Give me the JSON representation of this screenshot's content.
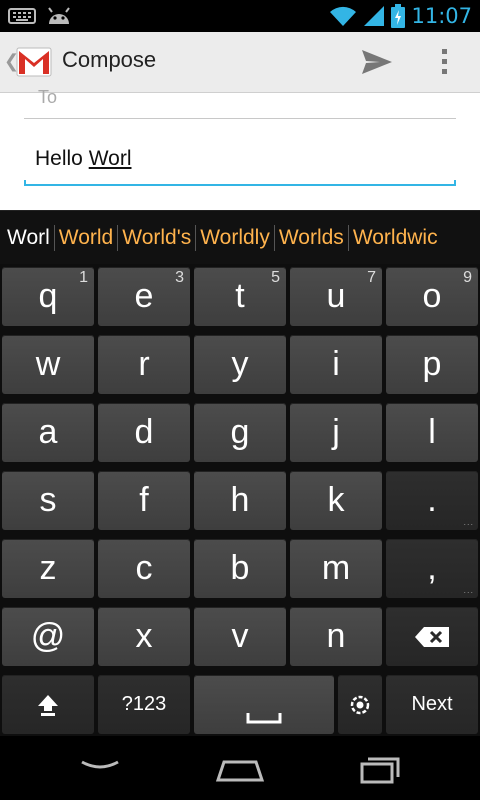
{
  "status": {
    "time": "11:07"
  },
  "actionbar": {
    "title": "Compose",
    "up_glyph": "❮"
  },
  "compose": {
    "to_label": "To",
    "body_prefix": "Hello ",
    "body_composing": "Worl"
  },
  "suggestions": [
    "Worl",
    "World",
    "World's",
    "Worldly",
    "Worlds",
    "Worldwic"
  ],
  "keyboard": {
    "row1": [
      {
        "label": "q",
        "hint": "1"
      },
      {
        "label": "e",
        "hint": "3"
      },
      {
        "label": "t",
        "hint": "5"
      },
      {
        "label": "u",
        "hint": "7"
      },
      {
        "label": "o",
        "hint": "9"
      }
    ],
    "row2": [
      {
        "label": "w"
      },
      {
        "label": "r"
      },
      {
        "label": "y"
      },
      {
        "label": "i"
      },
      {
        "label": "p"
      }
    ],
    "row3": [
      {
        "label": "a"
      },
      {
        "label": "d"
      },
      {
        "label": "g"
      },
      {
        "label": "j"
      },
      {
        "label": "l"
      }
    ],
    "row4": [
      {
        "label": "s"
      },
      {
        "label": "f"
      },
      {
        "label": "h"
      },
      {
        "label": "k"
      },
      {
        "label": "."
      }
    ],
    "row5": [
      {
        "label": "z"
      },
      {
        "label": "c"
      },
      {
        "label": "b"
      },
      {
        "label": "m"
      },
      {
        "label": ","
      }
    ],
    "row6": [
      {
        "label": "@"
      },
      {
        "label": "x"
      },
      {
        "label": "v"
      },
      {
        "label": "n"
      }
    ],
    "symbols_label": "?123",
    "next_label": "Next",
    "period_dots": "...",
    "comma_dots": "..."
  },
  "colors": {
    "accent": "#33b5e5",
    "suggestion": "#ffb34d",
    "gmail_red": "#d93025"
  },
  "icons": {
    "status_left": [
      "keyboard-icon",
      "android-icon"
    ],
    "status_right": [
      "wifi-icon",
      "signal-icon",
      "battery-icon"
    ],
    "actions": [
      "send-icon",
      "overflow-menu-icon"
    ],
    "keys": [
      "shift-icon",
      "space-icon",
      "settings-icon",
      "delete-icon"
    ],
    "nav": [
      "back-icon",
      "home-icon",
      "recent-apps-icon"
    ]
  }
}
